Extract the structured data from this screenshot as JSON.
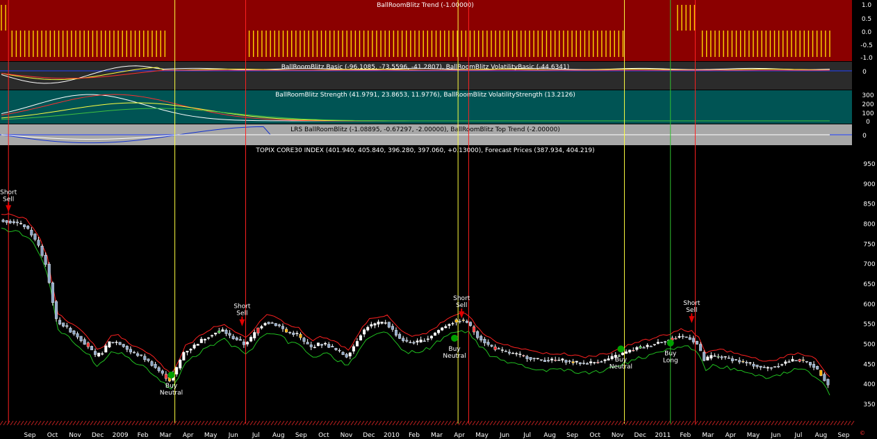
{
  "panels": {
    "trend": {
      "title": "BallRoomBlitz Trend (-1.00000)",
      "y_ticks": [
        "1.0",
        "0.5",
        "0.0",
        "-0.5",
        "-1.0"
      ],
      "ylim": [
        -1.2,
        1.2
      ]
    },
    "basic": {
      "title": "BallRoomBlitz Basic (-96.1085, -73.5596, -41.2807), BallRoomBlitz VolatilityBasic (-44.6341)",
      "y_ticks": [
        "0"
      ]
    },
    "strength": {
      "title": "BallRoomBlitz Strength (41.9791, 23.8653, 11.9776), BallRoomBlitz VolatilityStrength (13.2126)",
      "y_ticks": [
        "300",
        "200",
        "100",
        "0"
      ]
    },
    "lrs": {
      "title": "LRS BallRoomBlitz (-1.08895, -0.67297, -2.00000), BallRoomBlitz Top Trend (-2.00000)",
      "y_ticks": [
        "0"
      ]
    },
    "price": {
      "title": "TOPIX CORE30 INDEX (401.940, 405.840, 396.280, 397.060, +0.13000), Forecast Prices (387.934, 404.219)",
      "y_ticks": [
        "950",
        "900",
        "850",
        "800",
        "750",
        "700",
        "650",
        "600",
        "550",
        "500",
        "450",
        "400",
        "350"
      ]
    }
  },
  "x_axis_labels": [
    "Sep",
    "Oct",
    "Nov",
    "Dec",
    "2009",
    "Feb",
    "Mar",
    "Apr",
    "May",
    "Jun",
    "Jul",
    "Aug",
    "Sep",
    "Oct",
    "Nov",
    "Dec",
    "2010",
    "Feb",
    "Mar",
    "Apr",
    "May",
    "Jun",
    "Jul",
    "Aug",
    "Sep",
    "Oct",
    "Nov",
    "Dec",
    "2011",
    "Feb",
    "Mar",
    "Apr",
    "May",
    "Jun",
    "Jul",
    "Aug",
    "Sep"
  ],
  "signals": [
    {
      "line1": "Short",
      "line2": "Sell",
      "kind": "sell"
    },
    {
      "line1": "Buy",
      "line2": "Neutral",
      "kind": "buy"
    },
    {
      "line1": "Short",
      "line2": "Sell",
      "kind": "sell"
    },
    {
      "line1": "Short",
      "line2": "Sell",
      "kind": "sell"
    },
    {
      "line1": "Buy",
      "line2": "Neutral",
      "kind": "buy"
    },
    {
      "line1": "Buy",
      "line2": "Neutral",
      "kind": "buy"
    },
    {
      "line1": "Buy",
      "line2": "Long",
      "kind": "buy"
    },
    {
      "line1": "Short",
      "line2": "Sell",
      "kind": "sell"
    }
  ],
  "colors": {
    "trend_bg": "#8b0000",
    "basic_bg": "#2b2b2b",
    "strength_bg": "#005454",
    "lrs_bg": "#a8a8a8",
    "price_bg": "#000000",
    "sell": "#e00000",
    "buy": "#00a000",
    "upper_band": "#ff2020",
    "lower_band": "#20c020"
  },
  "chart_data": {
    "type": "candlestick",
    "title": "TOPIX CORE30 INDEX (401.940, 405.840, 396.280, 397.060, +0.13000), Forecast Prices (387.934, 404.219)",
    "ylim": [
      320,
      980
    ],
    "x_labels": [
      "Sep",
      "Oct",
      "Nov",
      "Dec",
      "2009",
      "Feb",
      "Mar",
      "Apr",
      "May",
      "Jun",
      "Jul",
      "Aug",
      "Sep",
      "Oct",
      "Nov",
      "Dec",
      "2010",
      "Feb",
      "Mar",
      "Apr",
      "May",
      "Jun",
      "Jul",
      "Aug",
      "Sep",
      "Oct",
      "Nov",
      "Dec",
      "2011",
      "Feb",
      "Mar",
      "Apr",
      "May",
      "Jun",
      "Jul",
      "Aug",
      "Sep"
    ],
    "close_path": [
      [
        0,
        810
      ],
      [
        4,
        805
      ],
      [
        7,
        795
      ],
      [
        9,
        775
      ],
      [
        11,
        745
      ],
      [
        13,
        700
      ],
      [
        16,
        560
      ],
      [
        19,
        540
      ],
      [
        22,
        520
      ],
      [
        25,
        495
      ],
      [
        27,
        470
      ],
      [
        29,
        480
      ],
      [
        31,
        505
      ],
      [
        33,
        505
      ],
      [
        35,
        495
      ],
      [
        37,
        480
      ],
      [
        40,
        470
      ],
      [
        43,
        450
      ],
      [
        46,
        425
      ],
      [
        48,
        410
      ],
      [
        50,
        440
      ],
      [
        52,
        480
      ],
      [
        54,
        490
      ],
      [
        57,
        510
      ],
      [
        60,
        525
      ],
      [
        63,
        535
      ],
      [
        65,
        520
      ],
      [
        67,
        512
      ],
      [
        69,
        500
      ],
      [
        71,
        515
      ],
      [
        73,
        540
      ],
      [
        75,
        555
      ],
      [
        77,
        552
      ],
      [
        79,
        545
      ],
      [
        81,
        530
      ],
      [
        84,
        525
      ],
      [
        86,
        505
      ],
      [
        88,
        492
      ],
      [
        90,
        500
      ],
      [
        92,
        500
      ],
      [
        94,
        490
      ],
      [
        96,
        480
      ],
      [
        98,
        470
      ],
      [
        100,
        495
      ],
      [
        102,
        525
      ],
      [
        104,
        545
      ],
      [
        107,
        552
      ],
      [
        109,
        555
      ],
      [
        111,
        535
      ],
      [
        113,
        515
      ],
      [
        115,
        505
      ],
      [
        118,
        505
      ],
      [
        121,
        515
      ],
      [
        124,
        535
      ],
      [
        127,
        552
      ],
      [
        130,
        560
      ],
      [
        132,
        555
      ],
      [
        135,
        520
      ],
      [
        138,
        498
      ],
      [
        141,
        485
      ],
      [
        144,
        478
      ],
      [
        147,
        472
      ],
      [
        150,
        465
      ],
      [
        153,
        460
      ],
      [
        156,
        460
      ],
      [
        159,
        460
      ],
      [
        162,
        455
      ],
      [
        165,
        452
      ],
      [
        168,
        455
      ],
      [
        171,
        460
      ],
      [
        174,
        470
      ],
      [
        177,
        480
      ],
      [
        180,
        490
      ],
      [
        183,
        495
      ],
      [
        186,
        505
      ],
      [
        189,
        510
      ],
      [
        192,
        520
      ],
      [
        195,
        515
      ],
      [
        197,
        500
      ],
      [
        199,
        460
      ],
      [
        201,
        470
      ],
      [
        204,
        468
      ],
      [
        207,
        462
      ],
      [
        210,
        455
      ],
      [
        213,
        448
      ],
      [
        216,
        440
      ],
      [
        219,
        445
      ],
      [
        222,
        455
      ],
      [
        225,
        462
      ],
      [
        228,
        455
      ],
      [
        230,
        445
      ],
      [
        232,
        425
      ],
      [
        234,
        400
      ]
    ],
    "y_ticks": [
      950,
      900,
      850,
      800,
      750,
      700,
      650,
      600,
      550,
      500,
      450,
      400,
      350
    ],
    "grid": false,
    "signal_positions": [
      {
        "t": 2,
        "price": 795
      },
      {
        "t": 48,
        "price": 430
      },
      {
        "t": 68,
        "price": 510
      },
      {
        "t": 130,
        "price": 530
      },
      {
        "t": 128,
        "price": 522
      },
      {
        "t": 175,
        "price": 495
      },
      {
        "t": 189,
        "price": 510
      },
      {
        "t": 195,
        "price": 518
      }
    ]
  }
}
